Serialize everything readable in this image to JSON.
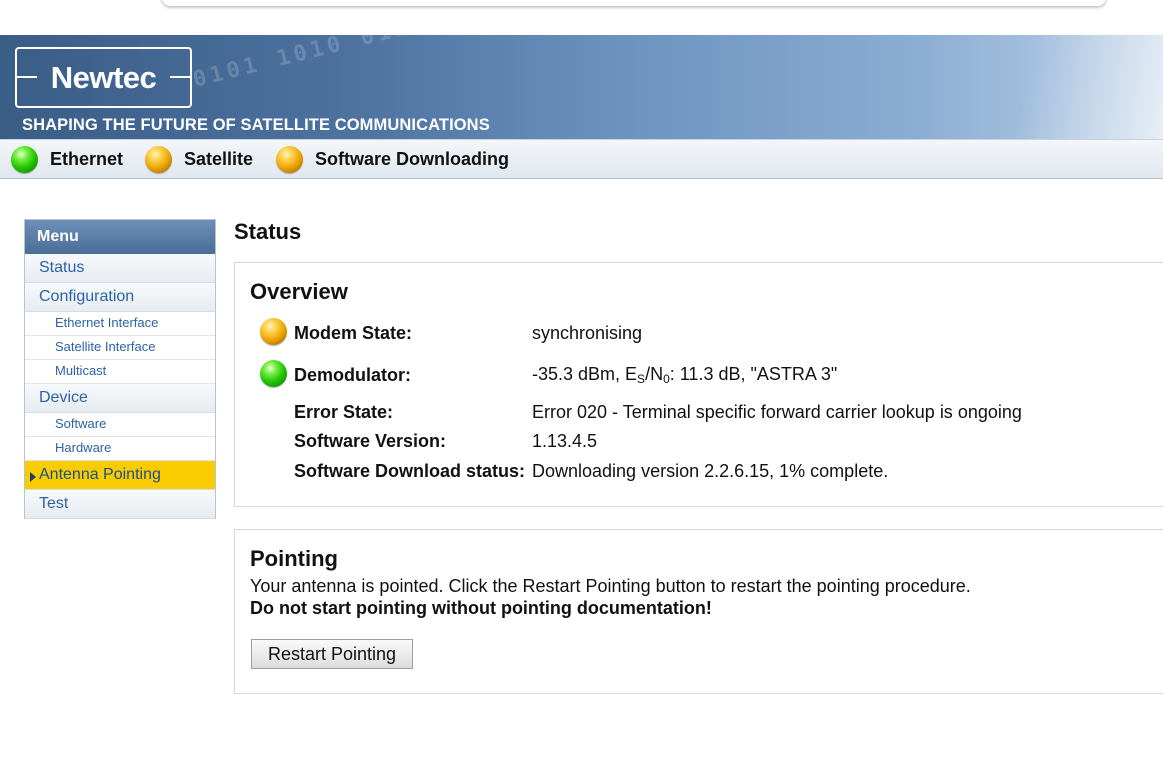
{
  "banner": {
    "logo_text": "Newtec",
    "tagline": "SHAPING THE FUTURE OF SATELLITE COMMUNICATIONS"
  },
  "statusbar": {
    "items": [
      {
        "label": "Ethernet",
        "state": "green"
      },
      {
        "label": "Satellite",
        "state": "orange"
      },
      {
        "label": "Software Downloading",
        "state": "orange"
      }
    ]
  },
  "menu": {
    "title": "Menu",
    "items": [
      {
        "label": "Status"
      },
      {
        "label": "Configuration"
      },
      {
        "label": "Ethernet Interface"
      },
      {
        "label": "Satellite Interface"
      },
      {
        "label": "Multicast"
      },
      {
        "label": "Device"
      },
      {
        "label": "Software"
      },
      {
        "label": "Hardware"
      },
      {
        "label": "Antenna Pointing",
        "active": true
      },
      {
        "label": "Test"
      }
    ]
  },
  "page": {
    "title": "Status"
  },
  "overview": {
    "heading": "Overview",
    "modem_state": {
      "label": "Modem State:",
      "value": "synchronising",
      "state": "orange"
    },
    "demodulator": {
      "label": "Demodulator:",
      "value_pre": "-35.3 dBm, E",
      "sub_s": "S",
      "slash": "/N",
      "sub_0": "0",
      "value_post": ": 11.3 dB, \"ASTRA 3\"",
      "state": "green"
    },
    "error_state": {
      "label": "Error State:",
      "value": "Error 020 - Terminal specific forward carrier lookup is ongoing"
    },
    "software_version": {
      "label": "Software Version:",
      "value": "1.13.4.5"
    },
    "download_status": {
      "label": "Software Download status:",
      "value": "Downloading version 2.2.6.15, 1% complete."
    }
  },
  "pointing": {
    "heading": "Pointing",
    "message": "Your antenna is pointed. Click the Restart Pointing button to restart the pointing procedure.",
    "warning": "Do not start pointing without pointing documentation!",
    "button_label": "Restart Pointing"
  },
  "colors": {
    "menu_active": "#f8cc00",
    "menu_link": "#2c62a6",
    "menu_header": "#4b6e98"
  }
}
